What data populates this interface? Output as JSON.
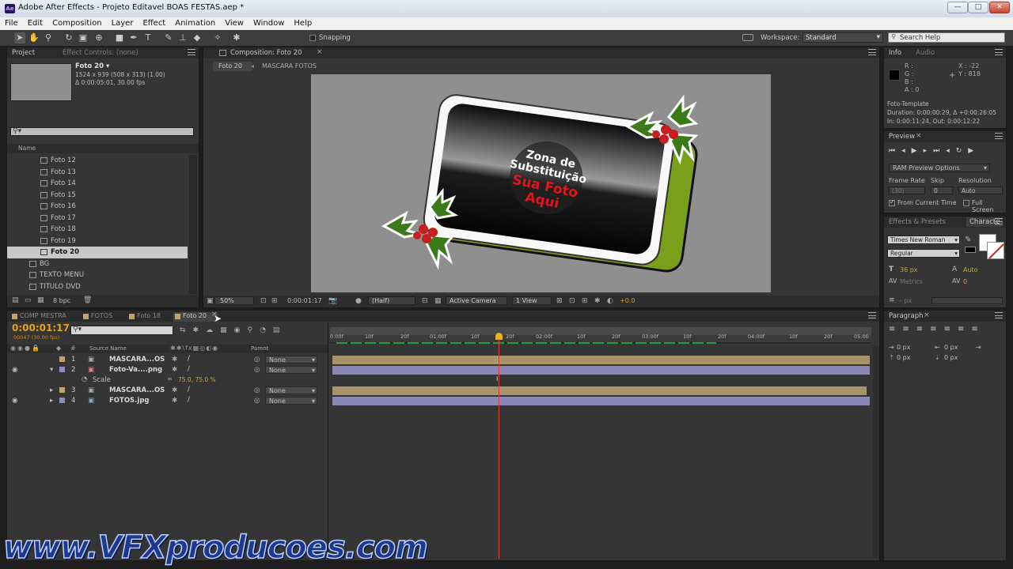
{
  "window": {
    "title": "Adobe After Effects - Projeto Editavel BOAS FESTAS.aep *",
    "logo": "Ae",
    "controls": [
      "—",
      "□",
      "✕"
    ]
  },
  "menu": [
    "File",
    "Edit",
    "Composition",
    "Layer",
    "Effect",
    "Animation",
    "View",
    "Window",
    "Help"
  ],
  "toolbar": {
    "snapping": "Snapping",
    "workspace_label": "Workspace:",
    "workspace_value": "Standard",
    "search_placeholder": "Search Help"
  },
  "project": {
    "tab_project": "Project",
    "tab_effect_controls": "Effect Controls: (none)",
    "selected_name": "Foto 20 ▾",
    "selected_size": "1524 x 939  (508 x 313) (1.00)",
    "selected_duration": "Δ 0:00:05:01, 30.00 fps",
    "col_name": "Name",
    "items": [
      "Foto 12",
      "Foto 13",
      "Foto 14",
      "Foto 15",
      "Foto 16",
      "Foto 17",
      "Foto 18",
      "Foto 19",
      "Foto 20",
      "BG",
      "TEXTO MENU",
      "TITULO DVD"
    ],
    "bpc": "8 bpc"
  },
  "composition": {
    "tab": "Composition: Foto 20",
    "breadcrumb_1": "Foto 20",
    "breadcrumb_2": "MASCARA FOTOS",
    "overlay_line1": "Zona de",
    "overlay_line2": "Substituição",
    "overlay_line3": "Sua Foto",
    "overlay_line4": "Aqui",
    "zoom": "50%",
    "timecode": "0:00:01:17",
    "resolution": "(Half)",
    "camera": "Active Camera",
    "views": "1 View",
    "exposure": "+0.0"
  },
  "info": {
    "tab_info": "Info",
    "tab_audio": "Audio",
    "r": "R :",
    "g": "G :",
    "b": "B :",
    "a": "A : 0",
    "x": "X : -22",
    "y": "Y : 818",
    "layer_name": "Foto-Template",
    "duration": "Duration: 0:00:00:29, Δ +0:00:26:05",
    "inout": "In: 0:00:11:24, Out: 0:00:12:22"
  },
  "preview": {
    "tab": "Preview",
    "ram_options": "RAM Preview Options",
    "frame_rate_label": "Frame Rate",
    "skip_label": "Skip",
    "resolution_label": "Resolution",
    "frame_rate_value": "(30)",
    "skip_value": "0",
    "resolution_value": "Auto",
    "from_current": "From Current Time",
    "full_screen": "Full Screen"
  },
  "character": {
    "tab_effects": "Effects & Presets",
    "tab_character": "Characte",
    "font": "Times New Roman",
    "style": "Regular",
    "size": "36 px",
    "leading": "Auto",
    "metrics": "Metrics",
    "tracking": "0",
    "stroke": "- px"
  },
  "paragraph": {
    "tab": "Paragraph",
    "indent1": "0 px",
    "indent2": "0 px",
    "indent3": "0 px",
    "indent4": "0 px"
  },
  "timeline": {
    "tabs": [
      {
        "label": "COMP MESTRA",
        "color": "#c9a15a"
      },
      {
        "label": "FOTOS",
        "color": "#c9a15a"
      },
      {
        "label": "Foto 18",
        "color": "#c9a15a"
      },
      {
        "label": "Foto 20",
        "color": "#c9a15a"
      }
    ],
    "timecode": "0:00:01:17",
    "frames": "00047 (30.00 fps)",
    "col_source": "Source Name",
    "col_parent": "Parent",
    "ruler": [
      "0:00f",
      "10f",
      "20f",
      "01:00f",
      "10f",
      "20f",
      "02:00f",
      "10f",
      "20f",
      "03:00f",
      "10f",
      "20f",
      "04:00f",
      "10f",
      "20f",
      "05:00"
    ],
    "layers": [
      {
        "num": "1",
        "name": "MASCARA...OS",
        "parent": "None",
        "color": "#c9a15a"
      },
      {
        "num": "2",
        "name": "Foto-Va....png",
        "parent": "None",
        "color": "#8f8ac5"
      },
      {
        "num": "3",
        "name": "MASCARA...OS",
        "parent": "None",
        "color": "#c9a15a"
      },
      {
        "num": "4",
        "name": "FOTOS.jpg",
        "parent": "None",
        "color": "#8f8ac5"
      }
    ],
    "scale_label": "Scale",
    "scale_value": "75.0, 75.0 %"
  },
  "watermark": "www.VFXproducoes.com"
}
